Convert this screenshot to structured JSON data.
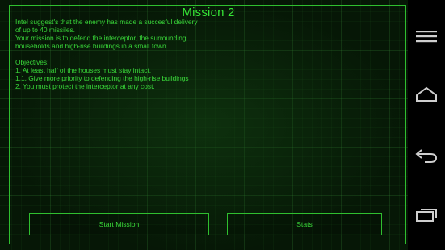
{
  "mission": {
    "title": "Mission 2",
    "briefing": [
      "Intel suggest's that the enemy has made a succesful delivery",
      "of up to 40 missiles.",
      "Your mission is to defend the interceptor, the surrounding",
      "households and high-rise buildings in a small town."
    ],
    "objectives_heading": "Objectives:",
    "objectives": [
      "1. At least half of the houses must stay intact.",
      "1.1. Give more priority to defending the high-rise buildings",
      "2. You must protect the interceptor at any cost."
    ]
  },
  "buttons": {
    "start_label": "Start Mission",
    "stats_label": "Stats"
  },
  "navbar": {
    "icons": [
      "menu-icon",
      "home-icon",
      "back-icon",
      "recent-apps-icon"
    ]
  },
  "colors": {
    "accent": "#35e335",
    "border": "#2fbf2f",
    "background": "#061706"
  }
}
